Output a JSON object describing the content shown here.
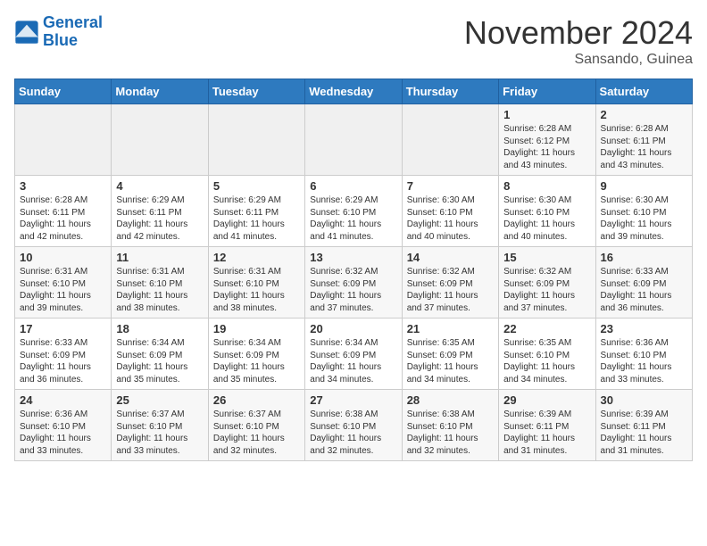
{
  "header": {
    "logo_line1": "General",
    "logo_line2": "Blue",
    "month_title": "November 2024",
    "subtitle": "Sansando, Guinea"
  },
  "weekdays": [
    "Sunday",
    "Monday",
    "Tuesday",
    "Wednesday",
    "Thursday",
    "Friday",
    "Saturday"
  ],
  "weeks": [
    [
      {
        "day": "",
        "empty": true
      },
      {
        "day": "",
        "empty": true
      },
      {
        "day": "",
        "empty": true
      },
      {
        "day": "",
        "empty": true
      },
      {
        "day": "",
        "empty": true
      },
      {
        "day": "1",
        "sunrise": "6:28 AM",
        "sunset": "6:12 PM",
        "daylight": "11 hours and 43 minutes."
      },
      {
        "day": "2",
        "sunrise": "6:28 AM",
        "sunset": "6:11 PM",
        "daylight": "11 hours and 43 minutes."
      }
    ],
    [
      {
        "day": "3",
        "sunrise": "6:28 AM",
        "sunset": "6:11 PM",
        "daylight": "11 hours and 42 minutes."
      },
      {
        "day": "4",
        "sunrise": "6:29 AM",
        "sunset": "6:11 PM",
        "daylight": "11 hours and 42 minutes."
      },
      {
        "day": "5",
        "sunrise": "6:29 AM",
        "sunset": "6:11 PM",
        "daylight": "11 hours and 41 minutes."
      },
      {
        "day": "6",
        "sunrise": "6:29 AM",
        "sunset": "6:10 PM",
        "daylight": "11 hours and 41 minutes."
      },
      {
        "day": "7",
        "sunrise": "6:30 AM",
        "sunset": "6:10 PM",
        "daylight": "11 hours and 40 minutes."
      },
      {
        "day": "8",
        "sunrise": "6:30 AM",
        "sunset": "6:10 PM",
        "daylight": "11 hours and 40 minutes."
      },
      {
        "day": "9",
        "sunrise": "6:30 AM",
        "sunset": "6:10 PM",
        "daylight": "11 hours and 39 minutes."
      }
    ],
    [
      {
        "day": "10",
        "sunrise": "6:31 AM",
        "sunset": "6:10 PM",
        "daylight": "11 hours and 39 minutes."
      },
      {
        "day": "11",
        "sunrise": "6:31 AM",
        "sunset": "6:10 PM",
        "daylight": "11 hours and 38 minutes."
      },
      {
        "day": "12",
        "sunrise": "6:31 AM",
        "sunset": "6:10 PM",
        "daylight": "11 hours and 38 minutes."
      },
      {
        "day": "13",
        "sunrise": "6:32 AM",
        "sunset": "6:09 PM",
        "daylight": "11 hours and 37 minutes."
      },
      {
        "day": "14",
        "sunrise": "6:32 AM",
        "sunset": "6:09 PM",
        "daylight": "11 hours and 37 minutes."
      },
      {
        "day": "15",
        "sunrise": "6:32 AM",
        "sunset": "6:09 PM",
        "daylight": "11 hours and 37 minutes."
      },
      {
        "day": "16",
        "sunrise": "6:33 AM",
        "sunset": "6:09 PM",
        "daylight": "11 hours and 36 minutes."
      }
    ],
    [
      {
        "day": "17",
        "sunrise": "6:33 AM",
        "sunset": "6:09 PM",
        "daylight": "11 hours and 36 minutes."
      },
      {
        "day": "18",
        "sunrise": "6:34 AM",
        "sunset": "6:09 PM",
        "daylight": "11 hours and 35 minutes."
      },
      {
        "day": "19",
        "sunrise": "6:34 AM",
        "sunset": "6:09 PM",
        "daylight": "11 hours and 35 minutes."
      },
      {
        "day": "20",
        "sunrise": "6:34 AM",
        "sunset": "6:09 PM",
        "daylight": "11 hours and 34 minutes."
      },
      {
        "day": "21",
        "sunrise": "6:35 AM",
        "sunset": "6:09 PM",
        "daylight": "11 hours and 34 minutes."
      },
      {
        "day": "22",
        "sunrise": "6:35 AM",
        "sunset": "6:10 PM",
        "daylight": "11 hours and 34 minutes."
      },
      {
        "day": "23",
        "sunrise": "6:36 AM",
        "sunset": "6:10 PM",
        "daylight": "11 hours and 33 minutes."
      }
    ],
    [
      {
        "day": "24",
        "sunrise": "6:36 AM",
        "sunset": "6:10 PM",
        "daylight": "11 hours and 33 minutes."
      },
      {
        "day": "25",
        "sunrise": "6:37 AM",
        "sunset": "6:10 PM",
        "daylight": "11 hours and 33 minutes."
      },
      {
        "day": "26",
        "sunrise": "6:37 AM",
        "sunset": "6:10 PM",
        "daylight": "11 hours and 32 minutes."
      },
      {
        "day": "27",
        "sunrise": "6:38 AM",
        "sunset": "6:10 PM",
        "daylight": "11 hours and 32 minutes."
      },
      {
        "day": "28",
        "sunrise": "6:38 AM",
        "sunset": "6:10 PM",
        "daylight": "11 hours and 32 minutes."
      },
      {
        "day": "29",
        "sunrise": "6:39 AM",
        "sunset": "6:11 PM",
        "daylight": "11 hours and 31 minutes."
      },
      {
        "day": "30",
        "sunrise": "6:39 AM",
        "sunset": "6:11 PM",
        "daylight": "11 hours and 31 minutes."
      }
    ]
  ]
}
